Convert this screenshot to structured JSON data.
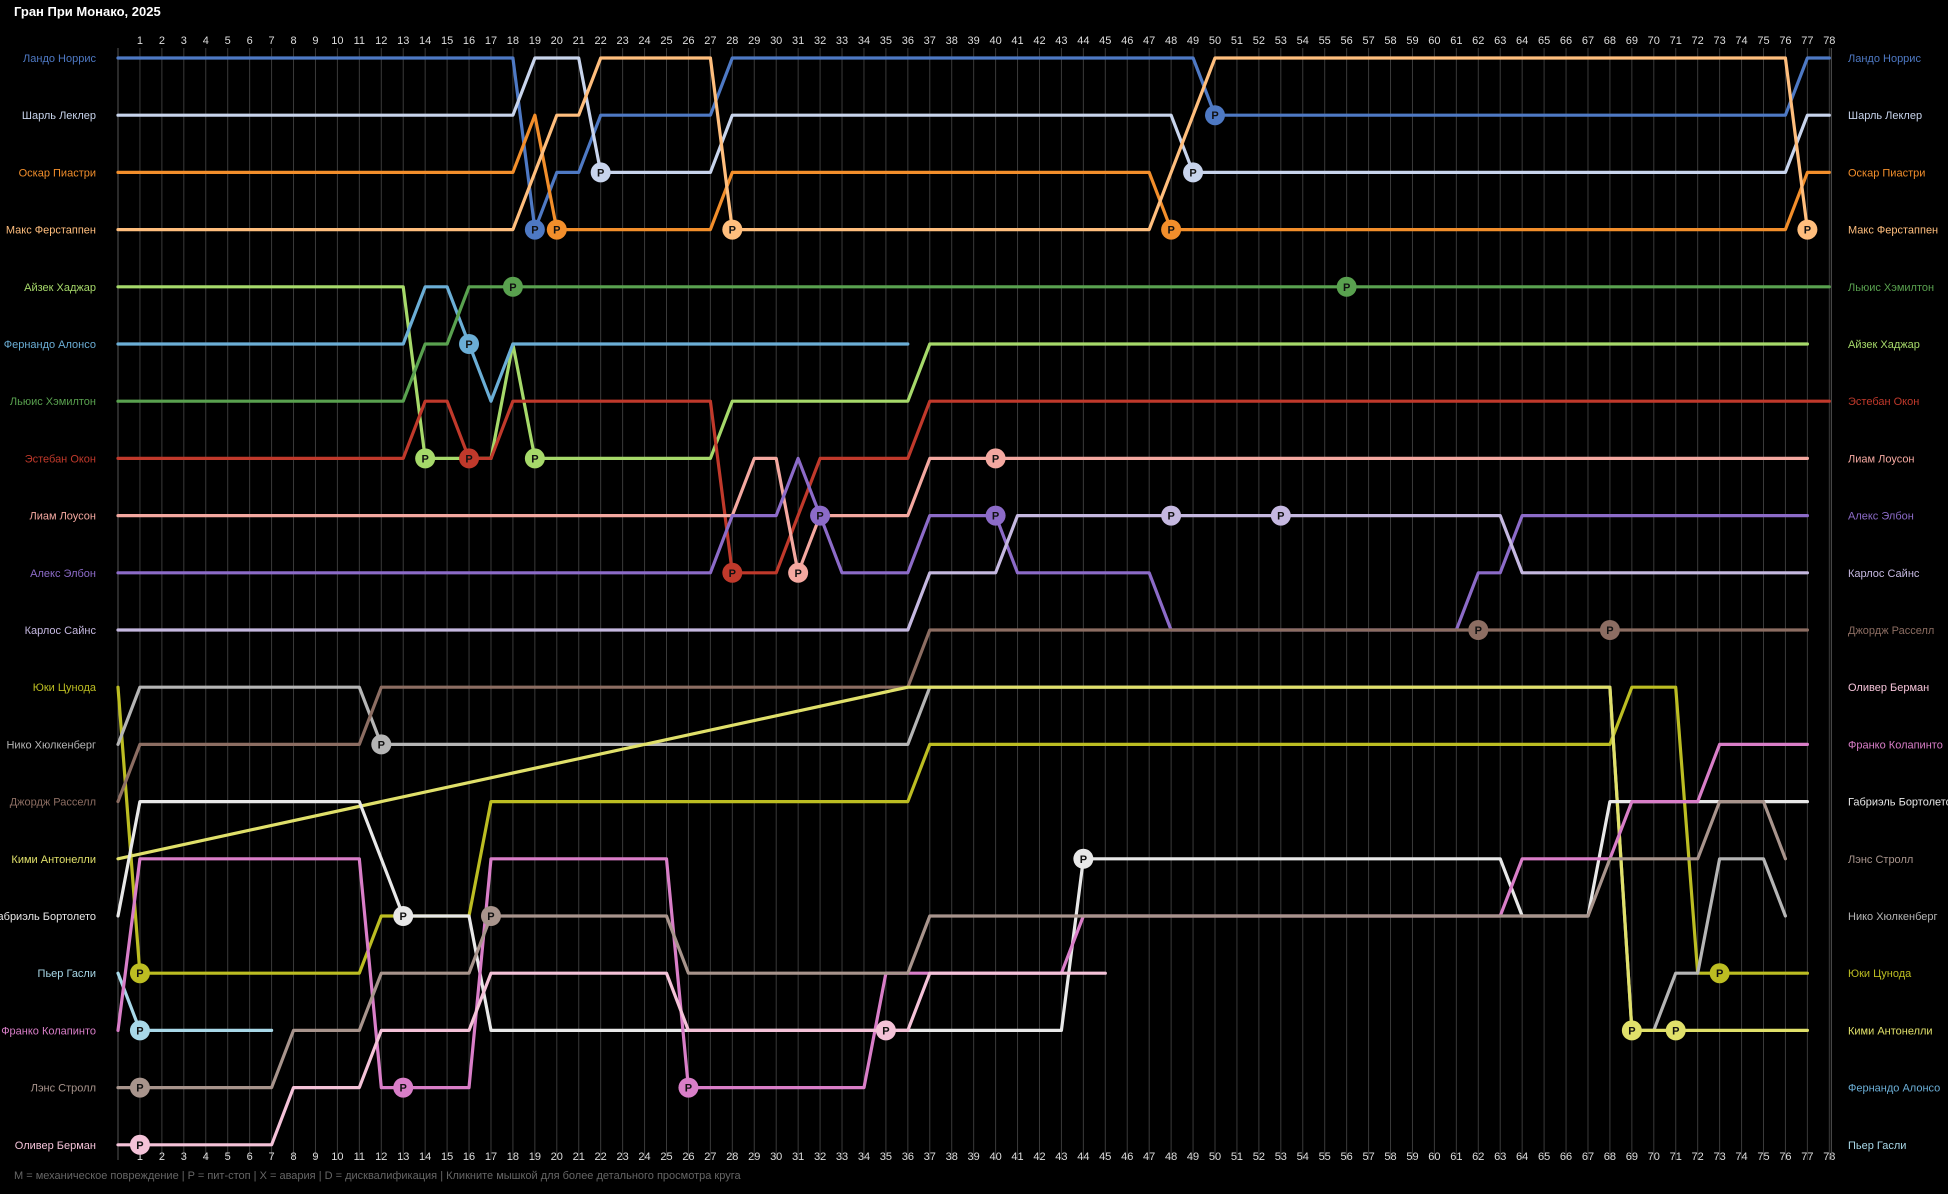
{
  "chart_data": {
    "type": "line",
    "title": "Гран При Монако, 2025",
    "xlabel": "",
    "ylabel": "",
    "x_ticks": [
      1,
      2,
      3,
      4,
      5,
      6,
      7,
      8,
      9,
      10,
      11,
      12,
      13,
      14,
      15,
      16,
      17,
      18,
      19,
      20,
      21,
      22,
      23,
      24,
      25,
      26,
      27,
      28,
      29,
      30,
      31,
      32,
      33,
      34,
      35,
      36,
      37,
      38,
      39,
      40,
      41,
      42,
      43,
      44,
      45,
      46,
      47,
      48,
      49,
      50,
      51,
      52,
      53,
      54,
      55,
      56,
      57,
      58,
      59,
      60,
      61,
      62,
      63,
      64,
      65,
      66,
      67,
      68,
      69,
      70,
      71,
      72,
      73,
      74,
      75,
      76,
      77,
      78
    ],
    "xlim": [
      0,
      78
    ],
    "ylim": [
      1,
      20
    ],
    "grid": true,
    "legend": "left and right margins",
    "left_labels": [
      "Ландо Норрис",
      "Шарль Леклер",
      "Оскар Пиастри",
      "Макс Ферстаппен",
      "Айзек Хаджар",
      "Фернандо Алонсо",
      "Льюис Хэмилтон",
      "Эстебан Окон",
      "Лиам Лоусон",
      "Алекс Элбон",
      "Карлос Сайнс",
      "Юки Цунода",
      "Нико Хюлкенберг",
      "Джордж Расселл",
      "Кими Антонелли",
      "Габриэль Бортолето",
      "Пьер Гасли",
      "Франко Колапинто",
      "Лэнс Стролл",
      "Оливер Берман"
    ],
    "right_labels": [
      "Ландо Норрис",
      "Шарль Леклер",
      "Оскар Пиастри",
      "Макс Ферстаппен",
      "Льюис Хэмилтон",
      "Айзек Хаджар",
      "Эстебан Окон",
      "Лиам Лоусон",
      "Алекс Элбон",
      "Карлос Сайнс",
      "Джордж Расселл",
      "Оливер Берман",
      "Франко Колапинто",
      "Габриэль Бортолето",
      "Лэнс Стролл",
      "Нико Хюлкенберг",
      "Юки Цунода",
      "Кими Антонелли",
      "Фернандо Алонсо",
      "Пьер Гасли"
    ],
    "footer": "M = механическое повреждение | P = пит-стоп | X = авария | D = дисквалификация | Кликните мышкой для более детального просмотра круга",
    "pit_marker_label": "P",
    "series": [
      {
        "name": "Ландо Норрис",
        "color": "#4e79c4",
        "grid": 1,
        "changes": [
          [
            18,
            1
          ],
          [
            19,
            4
          ],
          [
            20,
            3
          ],
          [
            21,
            3
          ],
          [
            22,
            2
          ],
          [
            27,
            2
          ],
          [
            28,
            1
          ],
          [
            49,
            1
          ],
          [
            50,
            2
          ],
          [
            76,
            2
          ],
          [
            77,
            1
          ],
          [
            78,
            1
          ]
        ],
        "pits": [
          19,
          50
        ]
      },
      {
        "name": "Шарль Леклер",
        "color": "#c8d4ec",
        "grid": 2,
        "changes": [
          [
            18,
            2
          ],
          [
            19,
            1
          ],
          [
            21,
            1
          ],
          [
            22,
            3
          ],
          [
            27,
            3
          ],
          [
            28,
            2
          ],
          [
            48,
            2
          ],
          [
            49,
            3
          ],
          [
            76,
            3
          ],
          [
            77,
            2
          ],
          [
            78,
            2
          ]
        ],
        "pits": [
          22,
          49
        ]
      },
      {
        "name": "Оскар Пиастри",
        "color": "#f28e2b",
        "grid": 3,
        "changes": [
          [
            18,
            3
          ],
          [
            19,
            2
          ],
          [
            20,
            4
          ],
          [
            27,
            4
          ],
          [
            28,
            3
          ],
          [
            47,
            3
          ],
          [
            48,
            4
          ],
          [
            76,
            4
          ],
          [
            77,
            3
          ],
          [
            78,
            3
          ]
        ],
        "pits": [
          20,
          48
        ]
      },
      {
        "name": "Макс Ферстаппен",
        "color": "#ffbe7d",
        "grid": 4,
        "changes": [
          [
            18,
            4
          ],
          [
            19,
            3
          ],
          [
            20,
            2
          ],
          [
            21,
            2
          ],
          [
            22,
            1
          ],
          [
            27,
            1
          ],
          [
            28,
            4
          ],
          [
            47,
            4
          ],
          [
            48,
            3
          ],
          [
            49,
            2
          ],
          [
            50,
            1
          ],
          [
            76,
            1
          ],
          [
            77,
            4
          ]
        ],
        "pits": [
          28,
          77
        ]
      },
      {
        "name": "Айзек Хаджар",
        "color": "#a6d96a",
        "grid": 5,
        "changes": [
          [
            13,
            5
          ],
          [
            14,
            8
          ],
          [
            17,
            8
          ],
          [
            18,
            6
          ],
          [
            19,
            8
          ],
          [
            27,
            8
          ],
          [
            28,
            7
          ],
          [
            36,
            7
          ],
          [
            37,
            6
          ],
          [
            77,
            6
          ]
        ],
        "pits": [
          14,
          19
        ]
      },
      {
        "name": "Фернандо Алонсо",
        "color": "#6baed6",
        "grid": 6,
        "changes": [
          [
            13,
            6
          ],
          [
            14,
            5
          ],
          [
            15,
            5
          ],
          [
            16,
            6
          ],
          [
            17,
            7
          ],
          [
            18,
            6
          ],
          [
            36,
            6
          ]
        ],
        "pits": [
          16
        ]
      },
      {
        "name": "Льюис Хэмилтон",
        "color": "#59a14f",
        "grid": 7,
        "changes": [
          [
            13,
            7
          ],
          [
            14,
            6
          ],
          [
            15,
            6
          ],
          [
            16,
            5
          ],
          [
            78,
            5
          ]
        ],
        "pits": [
          18,
          56
        ]
      },
      {
        "name": "Эстебан Окон",
        "color": "#c0392b",
        "grid": 8,
        "changes": [
          [
            13,
            8
          ],
          [
            14,
            7
          ],
          [
            15,
            7
          ],
          [
            16,
            8
          ],
          [
            17,
            8
          ],
          [
            18,
            7
          ],
          [
            27,
            7
          ],
          [
            28,
            10
          ],
          [
            30,
            10
          ],
          [
            31,
            9
          ],
          [
            32,
            8
          ],
          [
            36,
            8
          ],
          [
            37,
            7
          ],
          [
            78,
            7
          ]
        ],
        "pits": [
          16,
          28
        ]
      },
      {
        "name": "Лиам Лоусон",
        "color": "#f4a8a0",
        "grid": 9,
        "changes": [
          [
            27,
            9
          ],
          [
            28,
            9
          ],
          [
            29,
            8
          ],
          [
            30,
            8
          ],
          [
            31,
            10
          ],
          [
            32,
            9
          ],
          [
            36,
            9
          ],
          [
            37,
            8
          ],
          [
            77,
            8
          ]
        ],
        "pits": [
          31,
          40
        ]
      },
      {
        "name": "Алекс Элбон",
        "color": "#8c6bc8",
        "grid": 10,
        "changes": [
          [
            27,
            10
          ],
          [
            28,
            9
          ],
          [
            30,
            9
          ],
          [
            31,
            8
          ],
          [
            32,
            9
          ],
          [
            33,
            10
          ],
          [
            36,
            10
          ],
          [
            37,
            9
          ],
          [
            40,
            9
          ],
          [
            41,
            10
          ],
          [
            47,
            10
          ],
          [
            48,
            11
          ],
          [
            61,
            11
          ],
          [
            62,
            10
          ],
          [
            63,
            10
          ],
          [
            64,
            9
          ],
          [
            77,
            9
          ]
        ],
        "pits": [
          32,
          40
        ]
      },
      {
        "name": "Карлос Сайнс",
        "color": "#c5b8e0",
        "grid": 11,
        "changes": [
          [
            36,
            11
          ],
          [
            37,
            10
          ],
          [
            40,
            10
          ],
          [
            41,
            9
          ],
          [
            63,
            9
          ],
          [
            64,
            10
          ],
          [
            77,
            10
          ]
        ],
        "pits": [
          48,
          53
        ]
      },
      {
        "name": "Юки Цунода",
        "color": "#bcbd22",
        "grid": 12,
        "changes": [
          [
            1,
            17
          ],
          [
            11,
            17
          ],
          [
            12,
            16
          ],
          [
            16,
            16
          ],
          [
            17,
            14
          ],
          [
            36,
            14
          ],
          [
            37,
            13
          ],
          [
            68,
            13
          ],
          [
            69,
            12
          ],
          [
            71,
            12
          ],
          [
            72,
            17
          ],
          [
            77,
            17
          ]
        ],
        "pits": [
          1,
          73
        ]
      },
      {
        "name": "Нико Хюлкенберг",
        "color": "#b5b5b5",
        "grid": 13,
        "changes": [
          [
            1,
            12
          ],
          [
            11,
            12
          ],
          [
            12,
            13
          ],
          [
            36,
            13
          ],
          [
            37,
            12
          ],
          [
            68,
            12
          ],
          [
            69,
            18
          ],
          [
            70,
            18
          ],
          [
            71,
            17
          ],
          [
            72,
            17
          ],
          [
            73,
            15
          ],
          [
            75,
            15
          ],
          [
            76,
            16
          ]
        ],
        "pits": [
          12
        ]
      },
      {
        "name": "Джордж Расселл",
        "color": "#8c6d62",
        "grid": 14,
        "changes": [
          [
            1,
            13
          ],
          [
            11,
            13
          ],
          [
            12,
            12
          ],
          [
            36,
            12
          ],
          [
            37,
            11
          ],
          [
            77,
            11
          ]
        ],
        "pits": [
          62,
          68
        ]
      },
      {
        "name": "Кими Антонелли",
        "color": "#e0e06a",
        "grid": 15,
        "changes": [
          [
            36,
            12
          ],
          [
            37,
            12
          ],
          [
            68,
            12
          ],
          [
            69,
            18
          ],
          [
            77,
            18
          ]
        ],
        "pits": [
          69,
          71
        ]
      },
      {
        "name": "Габриэль Бортолето",
        "color": "#e8e8e8",
        "grid": 16,
        "changes": [
          [
            1,
            14
          ],
          [
            11,
            14
          ],
          [
            12,
            15
          ],
          [
            13,
            16
          ],
          [
            16,
            16
          ],
          [
            17,
            18
          ],
          [
            43,
            18
          ],
          [
            44,
            15
          ],
          [
            63,
            15
          ],
          [
            64,
            16
          ],
          [
            67,
            16
          ],
          [
            68,
            14
          ],
          [
            77,
            14
          ]
        ],
        "pits": [
          13,
          44
        ]
      },
      {
        "name": "Пьер Гасли",
        "color": "#a8d8e8",
        "grid": 17,
        "changes": [
          [
            1,
            18
          ],
          [
            7,
            18
          ]
        ],
        "pits": [
          1
        ]
      },
      {
        "name": "Франко Колапинто",
        "color": "#d97ec8",
        "grid": 18,
        "changes": [
          [
            1,
            15
          ],
          [
            11,
            15
          ],
          [
            12,
            19
          ],
          [
            16,
            19
          ],
          [
            17,
            15
          ],
          [
            25,
            15
          ],
          [
            26,
            19
          ],
          [
            34,
            19
          ],
          [
            35,
            17
          ],
          [
            43,
            17
          ],
          [
            44,
            16
          ],
          [
            63,
            16
          ],
          [
            64,
            15
          ],
          [
            68,
            15
          ],
          [
            69,
            14
          ],
          [
            72,
            14
          ],
          [
            73,
            13
          ],
          [
            77,
            13
          ]
        ],
        "pits": [
          13,
          26
        ]
      },
      {
        "name": "Лэнс Стролл",
        "color": "#a8948c",
        "grid": 19,
        "changes": [
          [
            1,
            19
          ],
          [
            7,
            19
          ],
          [
            8,
            18
          ],
          [
            11,
            18
          ],
          [
            12,
            17
          ],
          [
            16,
            17
          ],
          [
            17,
            16
          ],
          [
            25,
            16
          ],
          [
            26,
            17
          ],
          [
            36,
            17
          ],
          [
            37,
            16
          ],
          [
            67,
            16
          ],
          [
            68,
            15
          ],
          [
            72,
            15
          ],
          [
            73,
            14
          ],
          [
            75,
            14
          ],
          [
            76,
            15
          ]
        ],
        "pits": [
          1,
          17
        ]
      },
      {
        "name": "Оливер Берман",
        "color": "#f4c2d8",
        "grid": 20,
        "changes": [
          [
            1,
            20
          ],
          [
            7,
            20
          ],
          [
            8,
            19
          ],
          [
            11,
            19
          ],
          [
            12,
            18
          ],
          [
            16,
            18
          ],
          [
            17,
            17
          ],
          [
            25,
            17
          ],
          [
            26,
            18
          ],
          [
            36,
            18
          ],
          [
            37,
            17
          ],
          [
            44,
            17
          ],
          [
            45,
            17
          ]
        ],
        "pits": [
          1,
          35
        ]
      }
    ]
  }
}
